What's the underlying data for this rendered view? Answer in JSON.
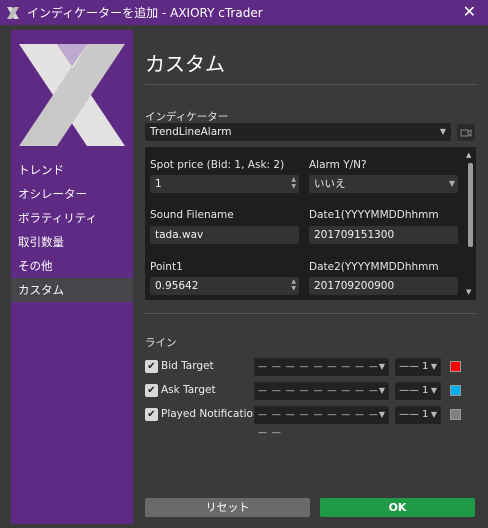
{
  "window": {
    "title": "インディケーターを追加 - AXIORY cTrader"
  },
  "sidebar": {
    "items": [
      {
        "label": "トレンド"
      },
      {
        "label": "オシレーター"
      },
      {
        "label": "ボラティリティ"
      },
      {
        "label": "取引数量"
      },
      {
        "label": "その他"
      },
      {
        "label": "カスタム",
        "active": true
      }
    ]
  },
  "main": {
    "title": "カスタム",
    "indicator_label": "インディケーター",
    "indicator_value": "TrendLineAlarm",
    "params": {
      "spot_label": "Spot price (Bid: 1, Ask: 2)",
      "spot_value": "1",
      "alarm_label": "Alarm Y/N?",
      "alarm_value": "いいえ",
      "sound_label": "Sound Filename",
      "sound_value": "tada.wav",
      "date1_label": "Date1(YYYYMMDDhhmm",
      "date1_value": "201709151300",
      "point1_label": "Point1",
      "point1_value": "0.95642",
      "date2_label": "Date2(YYYYMMDDhhmm",
      "date2_value": "201709200900"
    },
    "lines_label": "ライン",
    "lines": [
      {
        "label": "Bid Target",
        "dash": "— — — — — — — — — — —",
        "width": "1",
        "color": "#ff0000"
      },
      {
        "label": "Ask Target",
        "dash": "— — — — — — — — — — —",
        "width": "1",
        "color": "#00b0f0"
      },
      {
        "label": "Played Notification",
        "dash": "— — — — — — — — — — —",
        "width": "1",
        "color": "#808080"
      }
    ],
    "reset_label": "リセット",
    "ok_label": "OK"
  }
}
